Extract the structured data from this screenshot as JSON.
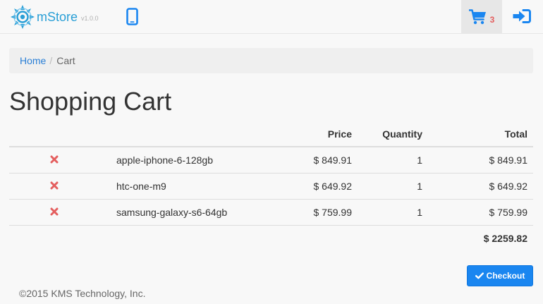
{
  "brand": {
    "name": "mStore",
    "version": "v1.0.0"
  },
  "nav": {
    "cart_count": "3"
  },
  "breadcrumb": {
    "home": "Home",
    "separator": "/",
    "current": "Cart"
  },
  "page_title": "Shopping Cart",
  "table": {
    "headers": {
      "price": "Price",
      "quantity": "Quantity",
      "total": "Total"
    },
    "rows": [
      {
        "product": "apple-iphone-6-128gb",
        "price": "$ 849.91",
        "quantity": "1",
        "total": "$ 849.91"
      },
      {
        "product": "htc-one-m9",
        "price": "$ 649.92",
        "quantity": "1",
        "total": "$ 649.92"
      },
      {
        "product": "samsung-galaxy-s6-64gb",
        "price": "$ 759.99",
        "quantity": "1",
        "total": "$ 759.99"
      }
    ],
    "grand_total": "$ 2259.82"
  },
  "checkout": {
    "label": "Checkout"
  },
  "footer": {
    "copyright": "©2015 KMS Technology, Inc."
  },
  "icons": {
    "logo": "mstore-logo-icon",
    "phone": "mobile-phone-icon",
    "cart": "shopping-cart-icon",
    "login": "sign-in-icon",
    "remove": "remove-x-icon",
    "check": "check-icon"
  },
  "colors": {
    "brand": "#2a9fd6",
    "accent_blue": "#1a86f0",
    "remove_red": "#e45e5e",
    "cart_count_red": "#e45e5e"
  }
}
